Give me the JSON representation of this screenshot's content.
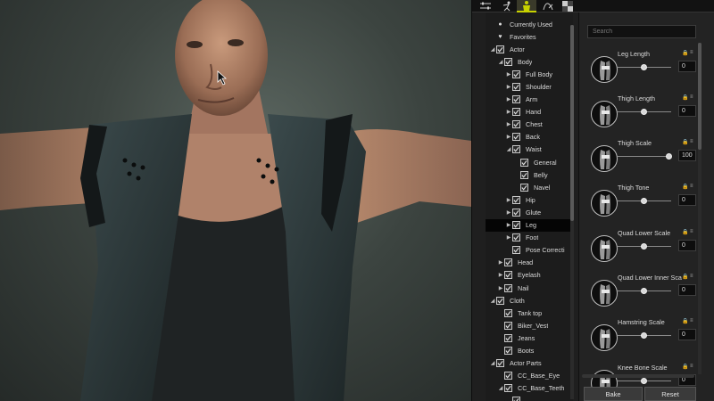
{
  "panel": {
    "tabs": [
      {
        "icon": "sliders-icon"
      },
      {
        "icon": "pose-figure-icon"
      },
      {
        "icon": "morph-icon",
        "active": true
      },
      {
        "icon": "body-shape-icon"
      },
      {
        "icon": "checker-texture-icon"
      }
    ],
    "accent_color": "#c8d200"
  },
  "tree": {
    "rows": [
      {
        "label": "Currently Used",
        "depth": 0,
        "kind": "dot",
        "arrow": ""
      },
      {
        "label": "Favorites",
        "depth": 0,
        "kind": "heart",
        "arrow": ""
      },
      {
        "label": "Actor",
        "depth": 0,
        "kind": "check",
        "arrow": "open"
      },
      {
        "label": "Body",
        "depth": 1,
        "kind": "check",
        "arrow": "open"
      },
      {
        "label": "Full Body",
        "depth": 2,
        "kind": "check",
        "arrow": "closed"
      },
      {
        "label": "Shoulder",
        "depth": 2,
        "kind": "check",
        "arrow": "closed"
      },
      {
        "label": "Arm",
        "depth": 2,
        "kind": "check",
        "arrow": "closed"
      },
      {
        "label": "Hand",
        "depth": 2,
        "kind": "check",
        "arrow": "closed"
      },
      {
        "label": "Chest",
        "depth": 2,
        "kind": "check",
        "arrow": "closed"
      },
      {
        "label": "Back",
        "depth": 2,
        "kind": "check",
        "arrow": "closed"
      },
      {
        "label": "Waist",
        "depth": 2,
        "kind": "check",
        "arrow": "open"
      },
      {
        "label": "General",
        "depth": 3,
        "kind": "check",
        "arrow": ""
      },
      {
        "label": "Belly",
        "depth": 3,
        "kind": "check",
        "arrow": ""
      },
      {
        "label": "Navel",
        "depth": 3,
        "kind": "check",
        "arrow": ""
      },
      {
        "label": "Hip",
        "depth": 2,
        "kind": "check",
        "arrow": "closed"
      },
      {
        "label": "Glute",
        "depth": 2,
        "kind": "check",
        "arrow": "closed"
      },
      {
        "label": "Leg",
        "depth": 2,
        "kind": "check",
        "arrow": "closed",
        "selected": true
      },
      {
        "label": "Foot",
        "depth": 2,
        "kind": "check",
        "arrow": "closed"
      },
      {
        "label": "Pose Correcti",
        "depth": 2,
        "kind": "check",
        "arrow": ""
      },
      {
        "label": "Head",
        "depth": 1,
        "kind": "check",
        "arrow": "closed"
      },
      {
        "label": "Eyelash",
        "depth": 1,
        "kind": "check",
        "arrow": "closed"
      },
      {
        "label": "Nail",
        "depth": 1,
        "kind": "check",
        "arrow": "closed"
      },
      {
        "label": "Cloth",
        "depth": 0,
        "kind": "check",
        "arrow": "open"
      },
      {
        "label": "Tank top",
        "depth": 1,
        "kind": "check",
        "arrow": ""
      },
      {
        "label": "Biker_Vest",
        "depth": 1,
        "kind": "check",
        "arrow": ""
      },
      {
        "label": "Jeans",
        "depth": 1,
        "kind": "check",
        "arrow": ""
      },
      {
        "label": "Boots",
        "depth": 1,
        "kind": "check",
        "arrow": ""
      },
      {
        "label": "Actor Parts",
        "depth": 0,
        "kind": "check",
        "arrow": "open"
      },
      {
        "label": "CC_Base_Eye",
        "depth": 1,
        "kind": "check",
        "arrow": ""
      },
      {
        "label": "CC_Base_Teeth",
        "depth": 1,
        "kind": "check",
        "arrow": "open"
      },
      {
        "label": "",
        "depth": 2,
        "kind": "check",
        "arrow": ""
      }
    ]
  },
  "morphs": {
    "search_placeholder": "Search",
    "sliders": [
      {
        "label": "Leg Length",
        "value": "0",
        "level": 0
      },
      {
        "label": "Thigh Length",
        "value": "0",
        "level": 0
      },
      {
        "label": "Thigh Scale",
        "value": "100",
        "level": 1
      },
      {
        "label": "Thigh Tone",
        "value": "0",
        "level": 0
      },
      {
        "label": "Quad Lower Scale",
        "value": "0",
        "level": 0
      },
      {
        "label": "Quad Lower Inner Sca",
        "value": "0",
        "level": 0
      },
      {
        "label": "Hamstring Scale",
        "value": "0",
        "level": 0
      },
      {
        "label": "Knee Bone Scale",
        "value": "0",
        "level": 0
      }
    ],
    "bake_label": "Bake",
    "reset_label": "Reset"
  }
}
